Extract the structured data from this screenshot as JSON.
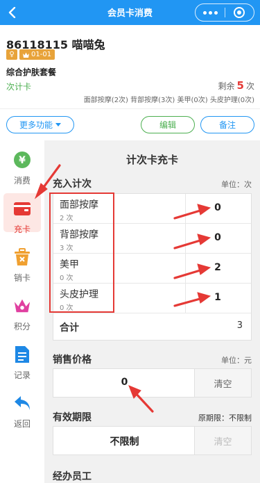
{
  "header": {
    "title": "会员卡消费"
  },
  "member": {
    "name": "86118115  喵喵兔",
    "gender_badge": "♀",
    "level": "01-01",
    "package": "综合护肤套餐",
    "card_type": "次计卡",
    "remain_prefix": "剩余",
    "remain_count": "5",
    "remain_suffix": "次",
    "items_line": "面部按摩(2次)  背部按摩(3次)  美甲(0次)  头皮护理(0次)",
    "buttons": {
      "more": "更多功能",
      "edit": "编辑",
      "note": "备注"
    }
  },
  "sidebar": {
    "items": [
      {
        "label": "消费",
        "icon": "yen-circle-icon"
      },
      {
        "label": "充卡",
        "icon": "wallet-icon"
      },
      {
        "label": "销卡",
        "icon": "trash-icon"
      },
      {
        "label": "积分",
        "icon": "crown-icon"
      },
      {
        "label": "记录",
        "icon": "document-icon"
      },
      {
        "label": "返回",
        "icon": "back-arrow-icon"
      }
    ]
  },
  "panel": {
    "title": "计次卡充卡",
    "recharge": {
      "title": "充入计次",
      "unit": "单位：次",
      "rows": [
        {
          "name": "面部按摩",
          "sub": "2 次",
          "value": "0"
        },
        {
          "name": "背部按摩",
          "sub": "3 次",
          "value": "0"
        },
        {
          "name": "美甲",
          "sub": "0 次",
          "value": "2"
        },
        {
          "name": "头皮护理",
          "sub": "0 次",
          "value": "1"
        }
      ],
      "total_label": "合计",
      "total_value": "3"
    },
    "price": {
      "title": "销售价格",
      "unit": "单位：元",
      "value": "0",
      "clear": "清空"
    },
    "validity": {
      "title": "有效期限",
      "note": "原期限：不限制",
      "value": "不限制",
      "clear": "清空"
    },
    "staff": {
      "title": "经办员工"
    }
  },
  "colors": {
    "primary": "#2196f3",
    "green": "#4caf50",
    "red": "#e53935",
    "badge": "#e8a33a"
  }
}
